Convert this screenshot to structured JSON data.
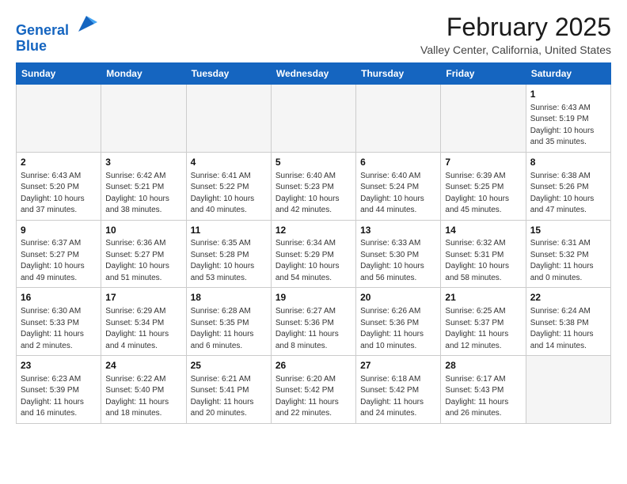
{
  "header": {
    "logo_line1": "General",
    "logo_line2": "Blue",
    "month": "February 2025",
    "location": "Valley Center, California, United States"
  },
  "weekdays": [
    "Sunday",
    "Monday",
    "Tuesday",
    "Wednesday",
    "Thursday",
    "Friday",
    "Saturday"
  ],
  "weeks": [
    [
      {
        "day": "",
        "info": ""
      },
      {
        "day": "",
        "info": ""
      },
      {
        "day": "",
        "info": ""
      },
      {
        "day": "",
        "info": ""
      },
      {
        "day": "",
        "info": ""
      },
      {
        "day": "",
        "info": ""
      },
      {
        "day": "1",
        "info": "Sunrise: 6:43 AM\nSunset: 5:19 PM\nDaylight: 10 hours\nand 35 minutes."
      }
    ],
    [
      {
        "day": "2",
        "info": "Sunrise: 6:43 AM\nSunset: 5:20 PM\nDaylight: 10 hours\nand 37 minutes."
      },
      {
        "day": "3",
        "info": "Sunrise: 6:42 AM\nSunset: 5:21 PM\nDaylight: 10 hours\nand 38 minutes."
      },
      {
        "day": "4",
        "info": "Sunrise: 6:41 AM\nSunset: 5:22 PM\nDaylight: 10 hours\nand 40 minutes."
      },
      {
        "day": "5",
        "info": "Sunrise: 6:40 AM\nSunset: 5:23 PM\nDaylight: 10 hours\nand 42 minutes."
      },
      {
        "day": "6",
        "info": "Sunrise: 6:40 AM\nSunset: 5:24 PM\nDaylight: 10 hours\nand 44 minutes."
      },
      {
        "day": "7",
        "info": "Sunrise: 6:39 AM\nSunset: 5:25 PM\nDaylight: 10 hours\nand 45 minutes."
      },
      {
        "day": "8",
        "info": "Sunrise: 6:38 AM\nSunset: 5:26 PM\nDaylight: 10 hours\nand 47 minutes."
      }
    ],
    [
      {
        "day": "9",
        "info": "Sunrise: 6:37 AM\nSunset: 5:27 PM\nDaylight: 10 hours\nand 49 minutes."
      },
      {
        "day": "10",
        "info": "Sunrise: 6:36 AM\nSunset: 5:27 PM\nDaylight: 10 hours\nand 51 minutes."
      },
      {
        "day": "11",
        "info": "Sunrise: 6:35 AM\nSunset: 5:28 PM\nDaylight: 10 hours\nand 53 minutes."
      },
      {
        "day": "12",
        "info": "Sunrise: 6:34 AM\nSunset: 5:29 PM\nDaylight: 10 hours\nand 54 minutes."
      },
      {
        "day": "13",
        "info": "Sunrise: 6:33 AM\nSunset: 5:30 PM\nDaylight: 10 hours\nand 56 minutes."
      },
      {
        "day": "14",
        "info": "Sunrise: 6:32 AM\nSunset: 5:31 PM\nDaylight: 10 hours\nand 58 minutes."
      },
      {
        "day": "15",
        "info": "Sunrise: 6:31 AM\nSunset: 5:32 PM\nDaylight: 11 hours\nand 0 minutes."
      }
    ],
    [
      {
        "day": "16",
        "info": "Sunrise: 6:30 AM\nSunset: 5:33 PM\nDaylight: 11 hours\nand 2 minutes."
      },
      {
        "day": "17",
        "info": "Sunrise: 6:29 AM\nSunset: 5:34 PM\nDaylight: 11 hours\nand 4 minutes."
      },
      {
        "day": "18",
        "info": "Sunrise: 6:28 AM\nSunset: 5:35 PM\nDaylight: 11 hours\nand 6 minutes."
      },
      {
        "day": "19",
        "info": "Sunrise: 6:27 AM\nSunset: 5:36 PM\nDaylight: 11 hours\nand 8 minutes."
      },
      {
        "day": "20",
        "info": "Sunrise: 6:26 AM\nSunset: 5:36 PM\nDaylight: 11 hours\nand 10 minutes."
      },
      {
        "day": "21",
        "info": "Sunrise: 6:25 AM\nSunset: 5:37 PM\nDaylight: 11 hours\nand 12 minutes."
      },
      {
        "day": "22",
        "info": "Sunrise: 6:24 AM\nSunset: 5:38 PM\nDaylight: 11 hours\nand 14 minutes."
      }
    ],
    [
      {
        "day": "23",
        "info": "Sunrise: 6:23 AM\nSunset: 5:39 PM\nDaylight: 11 hours\nand 16 minutes."
      },
      {
        "day": "24",
        "info": "Sunrise: 6:22 AM\nSunset: 5:40 PM\nDaylight: 11 hours\nand 18 minutes."
      },
      {
        "day": "25",
        "info": "Sunrise: 6:21 AM\nSunset: 5:41 PM\nDaylight: 11 hours\nand 20 minutes."
      },
      {
        "day": "26",
        "info": "Sunrise: 6:20 AM\nSunset: 5:42 PM\nDaylight: 11 hours\nand 22 minutes."
      },
      {
        "day": "27",
        "info": "Sunrise: 6:18 AM\nSunset: 5:42 PM\nDaylight: 11 hours\nand 24 minutes."
      },
      {
        "day": "28",
        "info": "Sunrise: 6:17 AM\nSunset: 5:43 PM\nDaylight: 11 hours\nand 26 minutes."
      },
      {
        "day": "",
        "info": ""
      }
    ]
  ]
}
